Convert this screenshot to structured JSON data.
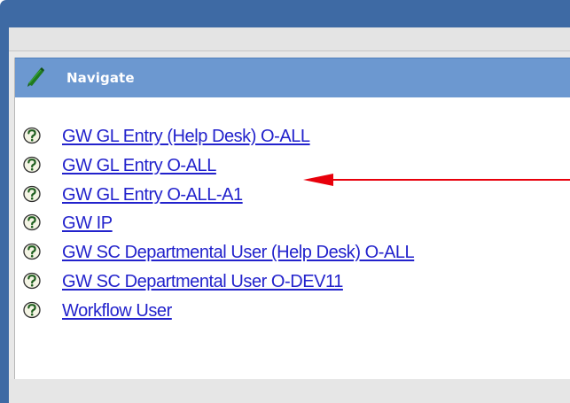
{
  "portlet": {
    "title": "Navigate"
  },
  "menu": {
    "items": [
      {
        "label": "GW GL Entry (Help Desk) O-ALL",
        "icon": "help-question-icon"
      },
      {
        "label": "GW GL Entry O-ALL",
        "icon": "help-question-icon"
      },
      {
        "label": "GW GL Entry O-ALL-A1",
        "icon": "help-question-icon"
      },
      {
        "label": "GW IP",
        "icon": "help-question-icon"
      },
      {
        "label": "GW SC Departmental User (Help Desk) O-ALL",
        "icon": "help-question-icon"
      },
      {
        "label": "GW SC Departmental User O-DEV11",
        "icon": "help-question-icon"
      },
      {
        "label": "Workflow User",
        "icon": "help-question-icon"
      }
    ]
  },
  "annotation": {
    "type": "arrow",
    "points_to": "GW GL Entry O-ALL",
    "color": "#e8000b"
  },
  "colors": {
    "window_frame": "#3e6aa4",
    "header_background": "#6c98d0",
    "link": "#2222cc",
    "panel": "#e8e8e8"
  }
}
